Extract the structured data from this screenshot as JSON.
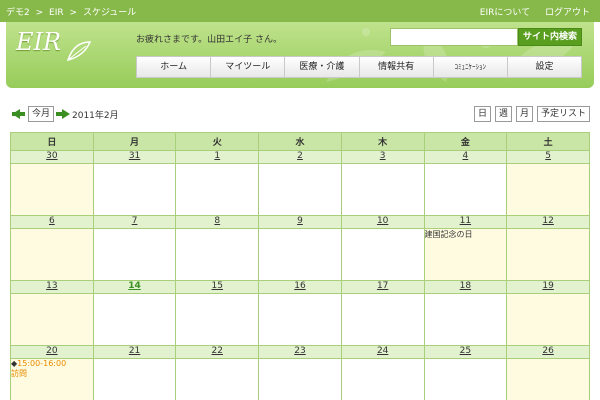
{
  "topbar": {
    "breadcrumb": [
      "デモ2",
      ">",
      "EIR",
      ">",
      "スケジュール"
    ],
    "about": "EIRについて",
    "logout": "ログアウト"
  },
  "header": {
    "logo": "EIR",
    "greeting": "お疲れさまです。山田エイ子 さん。",
    "search_placeholder": "",
    "search_button": "サイト内検索"
  },
  "nav": {
    "items": [
      "ホーム",
      "マイツール",
      "医療・介護",
      "情報共有",
      "ｺﾐｭﾆｹｰｼｮﾝ",
      "設定"
    ]
  },
  "toolbar": {
    "today": "今月",
    "month": "2011年2月",
    "views": [
      "日",
      "週",
      "月",
      "予定リスト"
    ]
  },
  "calendar": {
    "weekdays": [
      "日",
      "月",
      "火",
      "水",
      "木",
      "金",
      "土"
    ],
    "weeks": [
      {
        "dates": [
          "30",
          "31",
          "1",
          "2",
          "3",
          "4",
          "5"
        ]
      },
      {
        "dates": [
          "6",
          "7",
          "8",
          "9",
          "10",
          "11",
          "12"
        ],
        "holiday": {
          "index": 5,
          "name": "建国記念の日"
        }
      },
      {
        "dates": [
          "13",
          "14",
          "15",
          "16",
          "17",
          "18",
          "19"
        ],
        "today_index": 1
      },
      {
        "dates": [
          "20",
          "21",
          "22",
          "23",
          "24",
          "25",
          "26"
        ],
        "event": {
          "index": 0,
          "mark": "◆",
          "time": "15:00-16:00",
          "title": "訪問"
        }
      }
    ]
  },
  "colors": {
    "accent": "#86b84a",
    "header_gradient": "#97cc5a",
    "calendar_header": "#c9e6a6",
    "date_row": "#e2f2cf",
    "weekend": "#fffbe0",
    "event": "#e88a00"
  }
}
